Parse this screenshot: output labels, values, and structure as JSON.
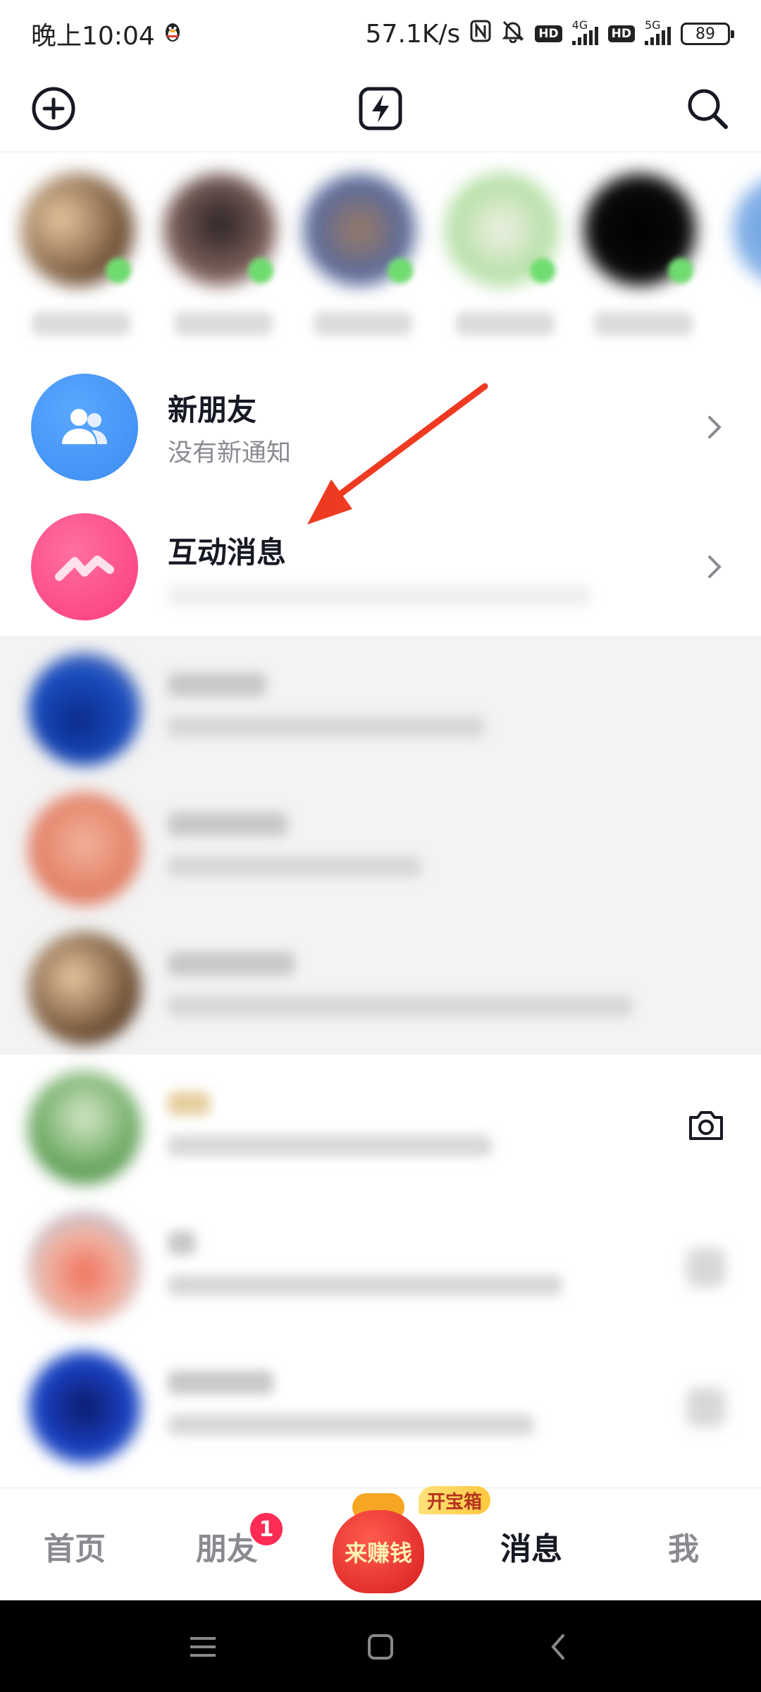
{
  "status_bar": {
    "time": "晚上10:04",
    "speed": "57.1K/s",
    "net1_tag": "4G",
    "net2_tag": "5G",
    "hd_label": "HD",
    "battery": "89"
  },
  "top_bar": {
    "add_icon": "plus-circle-icon",
    "center_icon": "lightning-icon",
    "search_icon": "search-icon"
  },
  "system_rows": {
    "new_friends": {
      "title": "新朋友",
      "subtitle": "没有新通知"
    },
    "interactions": {
      "title": "互动消息"
    }
  },
  "bottom_nav": {
    "home": "首页",
    "friends": "朋友",
    "friends_badge": "1",
    "earn": "来赚钱",
    "earn_tag": "开宝箱",
    "messages": "消息",
    "me": "我"
  },
  "colors": {
    "accent_red": "#fe2c55",
    "new_friends_blue": "#3d8bf2",
    "interaction_pink": "#fa3b7d",
    "annotation_arrow": "#ef3a22"
  }
}
